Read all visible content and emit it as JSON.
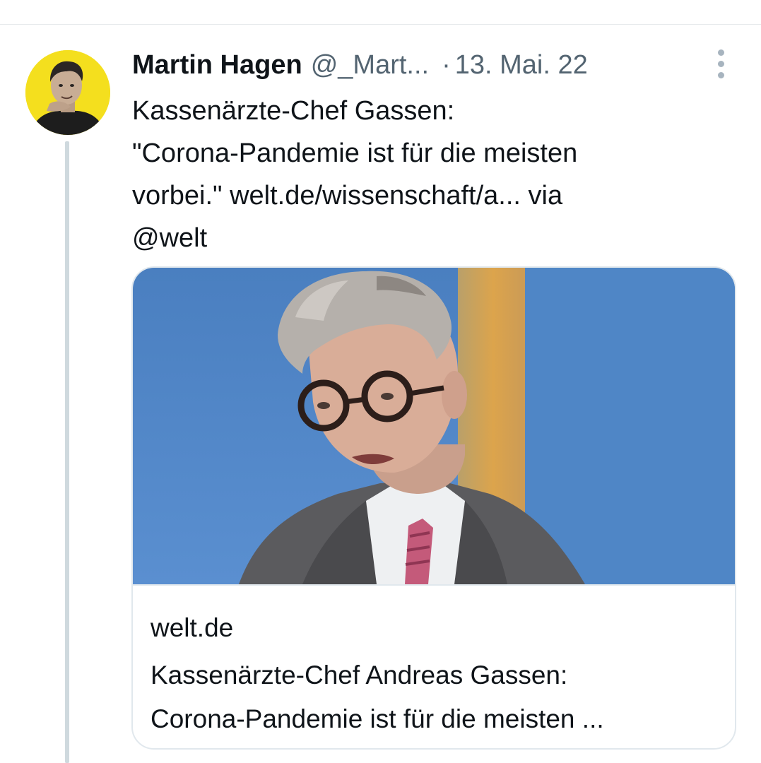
{
  "post": {
    "author_name": "Martin Hagen",
    "author_handle": "@_Mart...",
    "separator": "·",
    "date": "13. Mai. 22",
    "text_parts": {
      "line1": "Kassenärzte-Chef Gassen:",
      "line2": "\"Corona-Pandemie ist für die meisten",
      "line3_prefix": "vorbei.\" ",
      "link": "welt.de/wissenschaft/a...",
      "line3_suffix": " via",
      "mention": "@welt"
    }
  },
  "card": {
    "domain": "welt.de",
    "title_line1": "Kassenärzte-Chef Andreas Gassen:",
    "title_line2": "Corona-Pandemie ist für die meisten ..."
  },
  "colors": {
    "avatar_background": "#f4df1e",
    "thread_line": "#cfd9de",
    "secondary_text": "#536471",
    "card_border": "#e1e8ed",
    "photo_background_blue": "#4f86c6",
    "photo_background_orange": "#d9a04a"
  },
  "icons": {
    "more": "more-vertical-icon"
  }
}
